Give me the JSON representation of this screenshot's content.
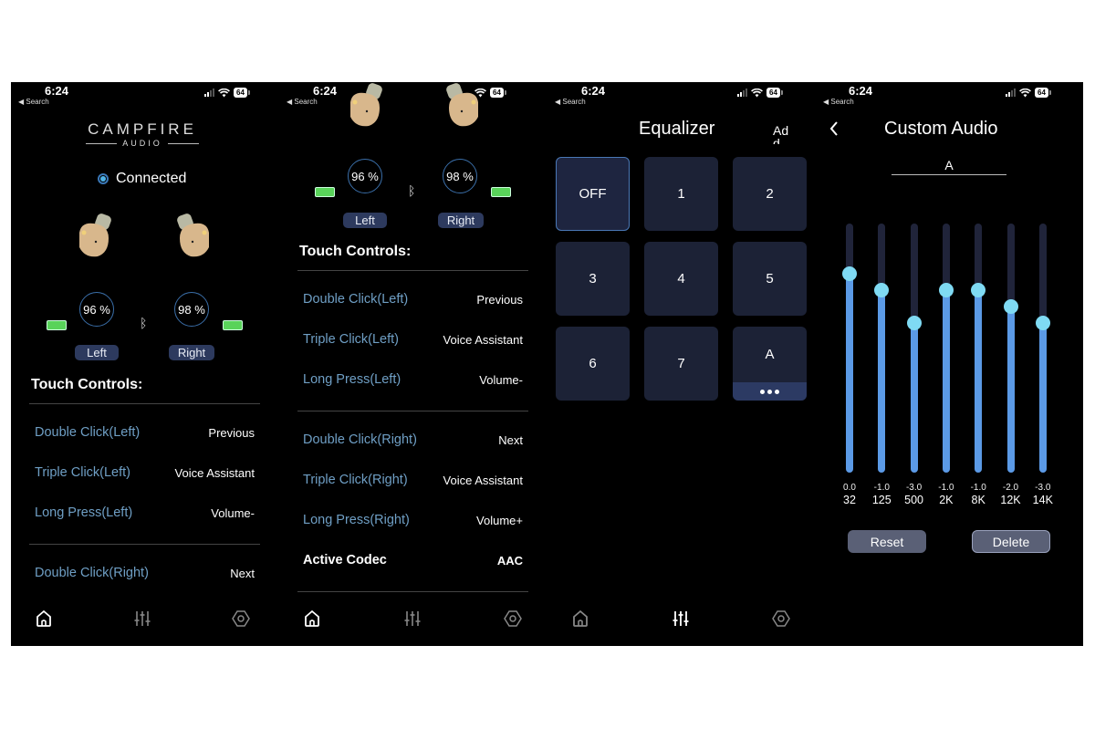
{
  "status_bar": {
    "time": "6:24",
    "back_label": "Search",
    "battery": "64"
  },
  "home": {
    "logo_top": "CAMPFIRE",
    "logo_bottom": "AUDIO",
    "connection_status": "Connected",
    "left": {
      "battery_percent": "96 %",
      "label": "Left"
    },
    "right": {
      "battery_percent": "98 %",
      "label": "Right"
    },
    "touch_controls_title": "Touch Controls:",
    "left_controls": [
      {
        "label": "Double Click(Left)",
        "value": "Previous"
      },
      {
        "label": "Triple Click(Left)",
        "value": "Voice Assistant"
      },
      {
        "label": "Long Press(Left)",
        "value": "Volume-"
      }
    ],
    "right_controls": [
      {
        "label": "Double Click(Right)",
        "value": "Next"
      },
      {
        "label": "Triple Click(Right)",
        "value": "Voice Assistant"
      },
      {
        "label": "Long Press(Right)",
        "value": "Volume+"
      }
    ],
    "codec": {
      "label": "Active Codec",
      "value": "AAC"
    }
  },
  "nav": {
    "items": [
      {
        "name": "home",
        "icon": "home-icon"
      },
      {
        "name": "equalizer",
        "icon": "sliders-icon"
      },
      {
        "name": "settings",
        "icon": "hexagon-gear-icon"
      }
    ]
  },
  "equalizer": {
    "title": "Equalizer",
    "add_label": "Add",
    "presets": [
      "OFF",
      "1",
      "2",
      "3",
      "4",
      "5",
      "6",
      "7",
      "A"
    ],
    "active_preset": "OFF"
  },
  "custom_audio": {
    "title": "Custom Audio",
    "preset_name": "A",
    "gain_range_db": [
      -12,
      3
    ],
    "bands": [
      {
        "freq": "32",
        "gain": "0.0",
        "value": 0.0
      },
      {
        "freq": "125",
        "gain": "-1.0",
        "value": -1.0
      },
      {
        "freq": "500",
        "gain": "-3.0",
        "value": -3.0
      },
      {
        "freq": "2K",
        "gain": "-1.0",
        "value": -1.0
      },
      {
        "freq": "8K",
        "gain": "-1.0",
        "value": -1.0
      },
      {
        "freq": "12K",
        "gain": "-2.0",
        "value": -2.0
      },
      {
        "freq": "14K",
        "gain": "-3.0",
        "value": -3.0
      }
    ],
    "reset_label": "Reset",
    "delete_label": "Delete"
  },
  "colors": {
    "accent_blue": "#5b9ae6",
    "knob": "#7fdaf3",
    "control_label": "#6f9fc5",
    "battery_green": "#59d35a",
    "tile_bg": "#1c2236"
  }
}
